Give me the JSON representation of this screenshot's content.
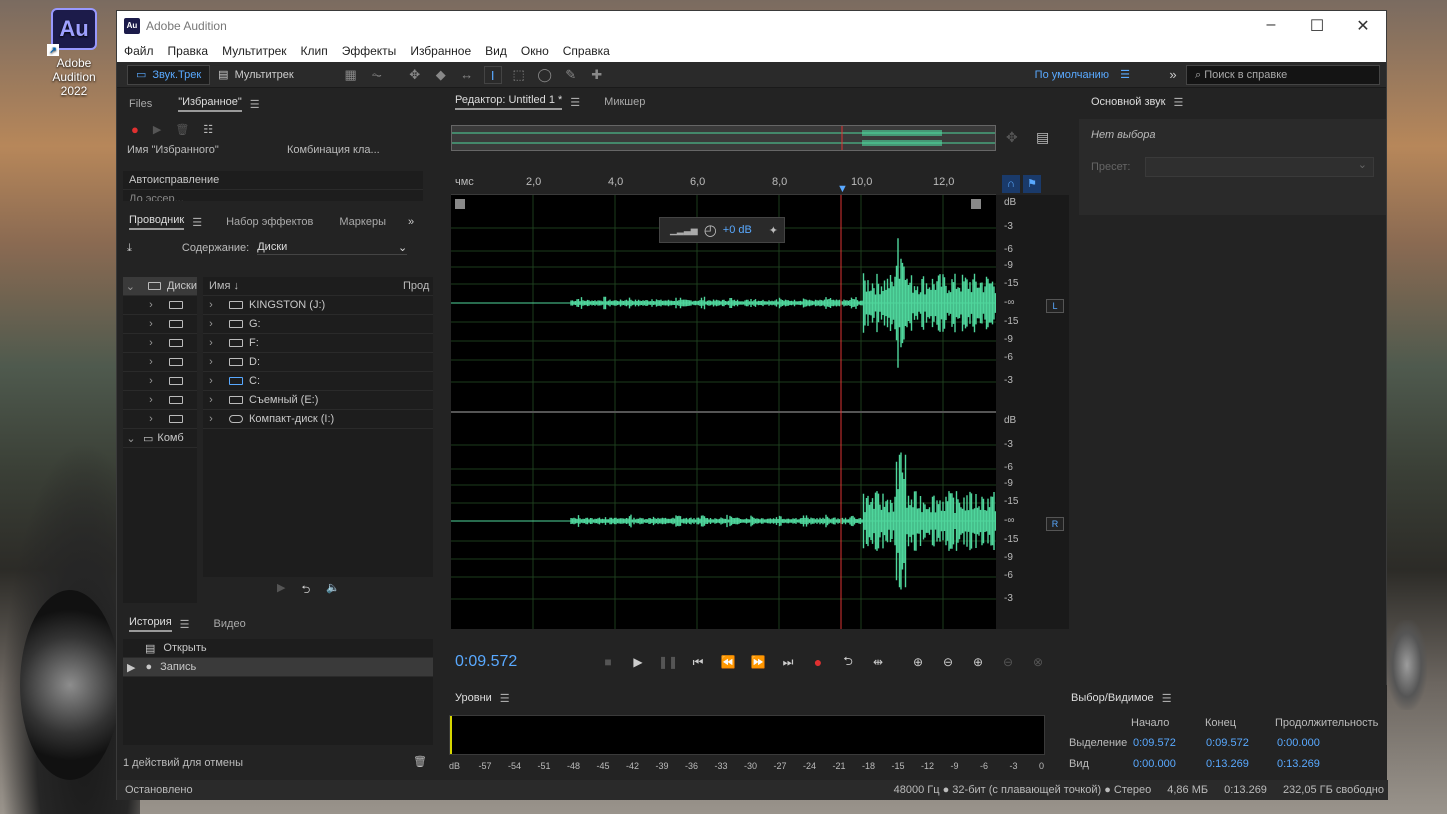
{
  "desktop": {
    "icon_label": "Adobe Audition 2022",
    "icon_text": "Au"
  },
  "window": {
    "title": "Adobe Audition",
    "app_icon": "Au"
  },
  "menu": [
    "Файл",
    "Правка",
    "Мультитрек",
    "Клип",
    "Эффекты",
    "Избранное",
    "Вид",
    "Окно",
    "Справка"
  ],
  "toolbar": {
    "waveform_label": "Звук.Трек",
    "multitrack_label": "Мультитрек",
    "workspace": "По умолчанию",
    "search_placeholder": "Поиск в справке"
  },
  "files_panel": {
    "tabs": [
      "Files",
      "\"Избранное\""
    ],
    "col_name": "Имя \"Избранного\"",
    "col_shortcut": "Комбинация кла...",
    "items": [
      "Автоисправление",
      "До эссер..."
    ]
  },
  "explorer_panel": {
    "tabs": [
      "Проводник",
      "Набор эффектов",
      "Маркеры"
    ],
    "content_label": "Содержание:",
    "content_value": "Диски",
    "tree_root": "Диски",
    "tree_combo": "Комб",
    "col_name": "Имя",
    "col_type": "Прод",
    "drives": [
      "KINGSTON (J:)",
      "G:",
      "F:",
      "D:",
      "C:",
      "Съемный (E:)",
      "Компакт-диск (I:)"
    ]
  },
  "history_panel": {
    "tabs": [
      "История",
      "Видео"
    ],
    "items": [
      "Открыть",
      "Запись"
    ],
    "footer": "1 действий для отмены"
  },
  "editor": {
    "tabs": [
      "Редактор: Untitled 1 *",
      "Микшер"
    ],
    "ruler_unit": "чмс",
    "ruler_ticks": [
      "2,0",
      "4,0",
      "6,0",
      "8,0",
      "10,0",
      "12,0"
    ],
    "gain": "+0 dB",
    "db_labels": [
      "dB",
      "-3",
      "-6",
      "-9",
      "-15",
      "-∞",
      "-15",
      "-9",
      "-6",
      "-3"
    ],
    "channel_left": "L",
    "channel_right": "R",
    "current_time": "0:09.572"
  },
  "essential_panel": {
    "title": "Основной звук",
    "no_selection": "Нет выбора",
    "preset_label": "Пресет:"
  },
  "levels_panel": {
    "title": "Уровни",
    "scale": [
      "dB",
      "-57",
      "-54",
      "-51",
      "-48",
      "-45",
      "-42",
      "-39",
      "-36",
      "-33",
      "-30",
      "-27",
      "-24",
      "-21",
      "-18",
      "-15",
      "-12",
      "-9",
      "-6",
      "-3",
      "0"
    ]
  },
  "selection_panel": {
    "title": "Выбор/Видимое",
    "headers": [
      "Начало",
      "Конец",
      "Продолжительность"
    ],
    "rows": [
      {
        "label": "Выделение",
        "start": "0:09.572",
        "end": "0:09.572",
        "duration": "0:00.000"
      },
      {
        "label": "Вид",
        "start": "0:00.000",
        "end": "0:13.269",
        "duration": "0:13.269"
      }
    ]
  },
  "status": {
    "left": "Остановлено",
    "format": "48000 Гц ● 32-бит (с плавающей точкой) ● Стерео",
    "size": "4,86 МБ",
    "duration": "0:13.269",
    "free": "232,05 ГБ свободно"
  }
}
